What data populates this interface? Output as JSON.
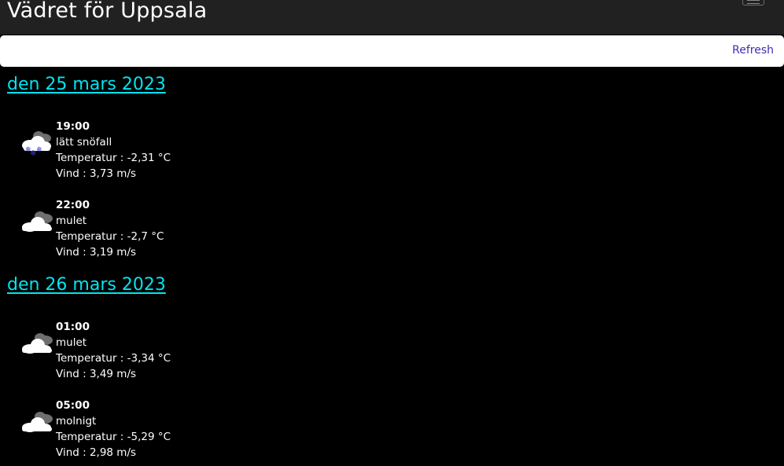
{
  "app": {
    "title": "Vädret för Uppsala"
  },
  "toolbar": {
    "refresh_label": "Refresh"
  },
  "colors": {
    "heading": "#00e5f0",
    "link": "#3e2fb3",
    "background": "#000000",
    "topbar": "#212121"
  },
  "days": [
    {
      "date": "den 25 mars 2023",
      "forecasts": [
        {
          "time": "19:00",
          "desc": "lätt snöfall",
          "temp": "Temperatur : -2,31 °C",
          "wind": "Vind : 3,73 m/s",
          "icon": "light-snow-icon"
        },
        {
          "time": "22:00",
          "desc": "mulet",
          "temp": "Temperatur : -2,7 °C",
          "wind": "Vind : 3,19 m/s",
          "icon": "overcast-cloud-icon"
        }
      ]
    },
    {
      "date": "den 26 mars 2023",
      "forecasts": [
        {
          "time": "01:00",
          "desc": "mulet",
          "temp": "Temperatur : -3,34 °C",
          "wind": "Vind : 3,49 m/s",
          "icon": "overcast-cloud-icon"
        },
        {
          "time": "05:00",
          "desc": "molnigt",
          "temp": "Temperatur : -5,29 °C",
          "wind": "Vind : 2,98 m/s",
          "icon": "cloudy-icon"
        }
      ]
    }
  ]
}
